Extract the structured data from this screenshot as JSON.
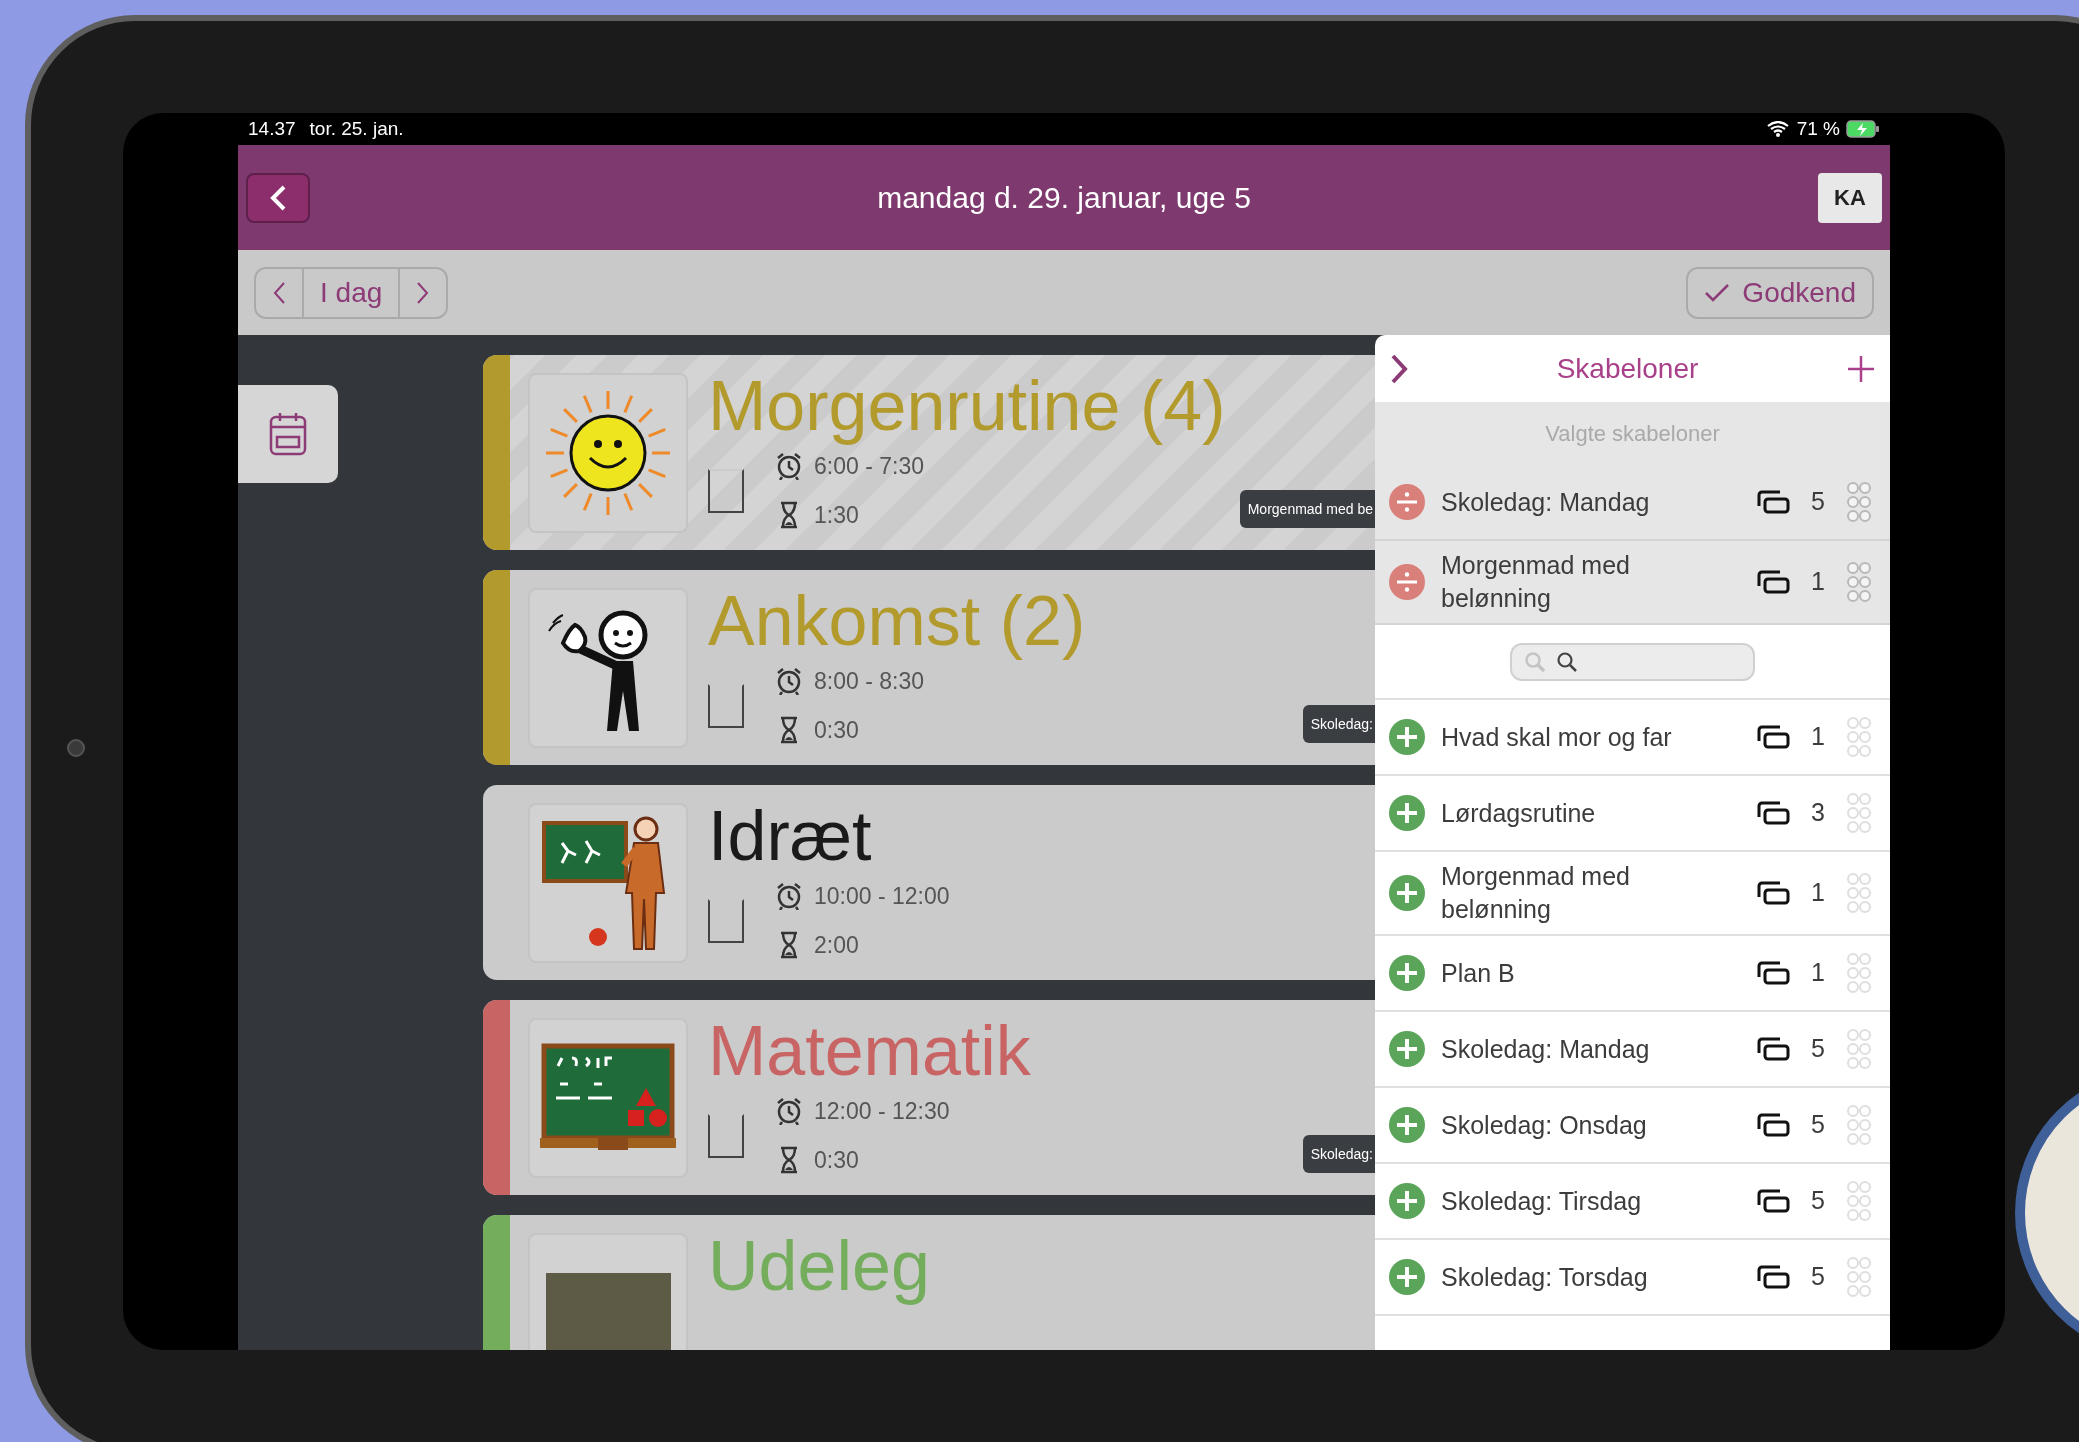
{
  "status_bar": {
    "time": "14.37",
    "date": "tor. 25. jan.",
    "battery": "71 %"
  },
  "header": {
    "title": "mandag d. 29. januar, uge 5",
    "user_button": "KA"
  },
  "toolbar": {
    "today_button": "I dag",
    "approve_button": "Godkend"
  },
  "activities": [
    {
      "title": "Morgenrutine (4)",
      "kind": "sun",
      "color": "#b39a2d",
      "bar": true,
      "striped": true,
      "checked": false,
      "time": "6:00 - 7:30",
      "duration": "1:30",
      "tag": "Morgenmad med be"
    },
    {
      "title": "Ankomst (2)",
      "kind": "wave",
      "color": "#b39a2d",
      "bar": true,
      "striped": false,
      "checked": false,
      "time": "8:00 - 8:30",
      "duration": "0:30",
      "tag": "Skoledag:"
    },
    {
      "title": "Idræt",
      "kind": "sport",
      "color": "#1a1a1a",
      "bar": false,
      "striped": false,
      "checked": false,
      "time": "10:00 - 12:00",
      "duration": "2:00"
    },
    {
      "title": "Matematik",
      "kind": "math",
      "color": "#c96464",
      "bar": true,
      "striped": false,
      "checked": false,
      "time": "12:00 - 12:30",
      "duration": "0:30",
      "tag": "Skoledag:"
    },
    {
      "title": "Udeleg",
      "kind": "photo",
      "color": "#74ad5c",
      "bar": true,
      "striped": false
    }
  ],
  "templates_panel": {
    "title": "Skabeloner",
    "selected_heading": "Valgte skabeloner",
    "selected": [
      {
        "name": "Skoledag: Mandag",
        "count": "5"
      },
      {
        "name": "Morgenmad med belønning",
        "count": "1"
      }
    ],
    "available": [
      {
        "name": "Hvad skal mor og far",
        "count": "1"
      },
      {
        "name": "Lørdagsrutine",
        "count": "3"
      },
      {
        "name": "Morgenmad med belønning",
        "count": "1"
      },
      {
        "name": "Plan B",
        "count": "1"
      },
      {
        "name": "Skoledag: Mandag",
        "count": "5"
      },
      {
        "name": "Skoledag: Onsdag",
        "count": "5"
      },
      {
        "name": "Skoledag: Tirsdag",
        "count": "5"
      },
      {
        "name": "Skoledag: Torsdag",
        "count": "5"
      }
    ]
  }
}
